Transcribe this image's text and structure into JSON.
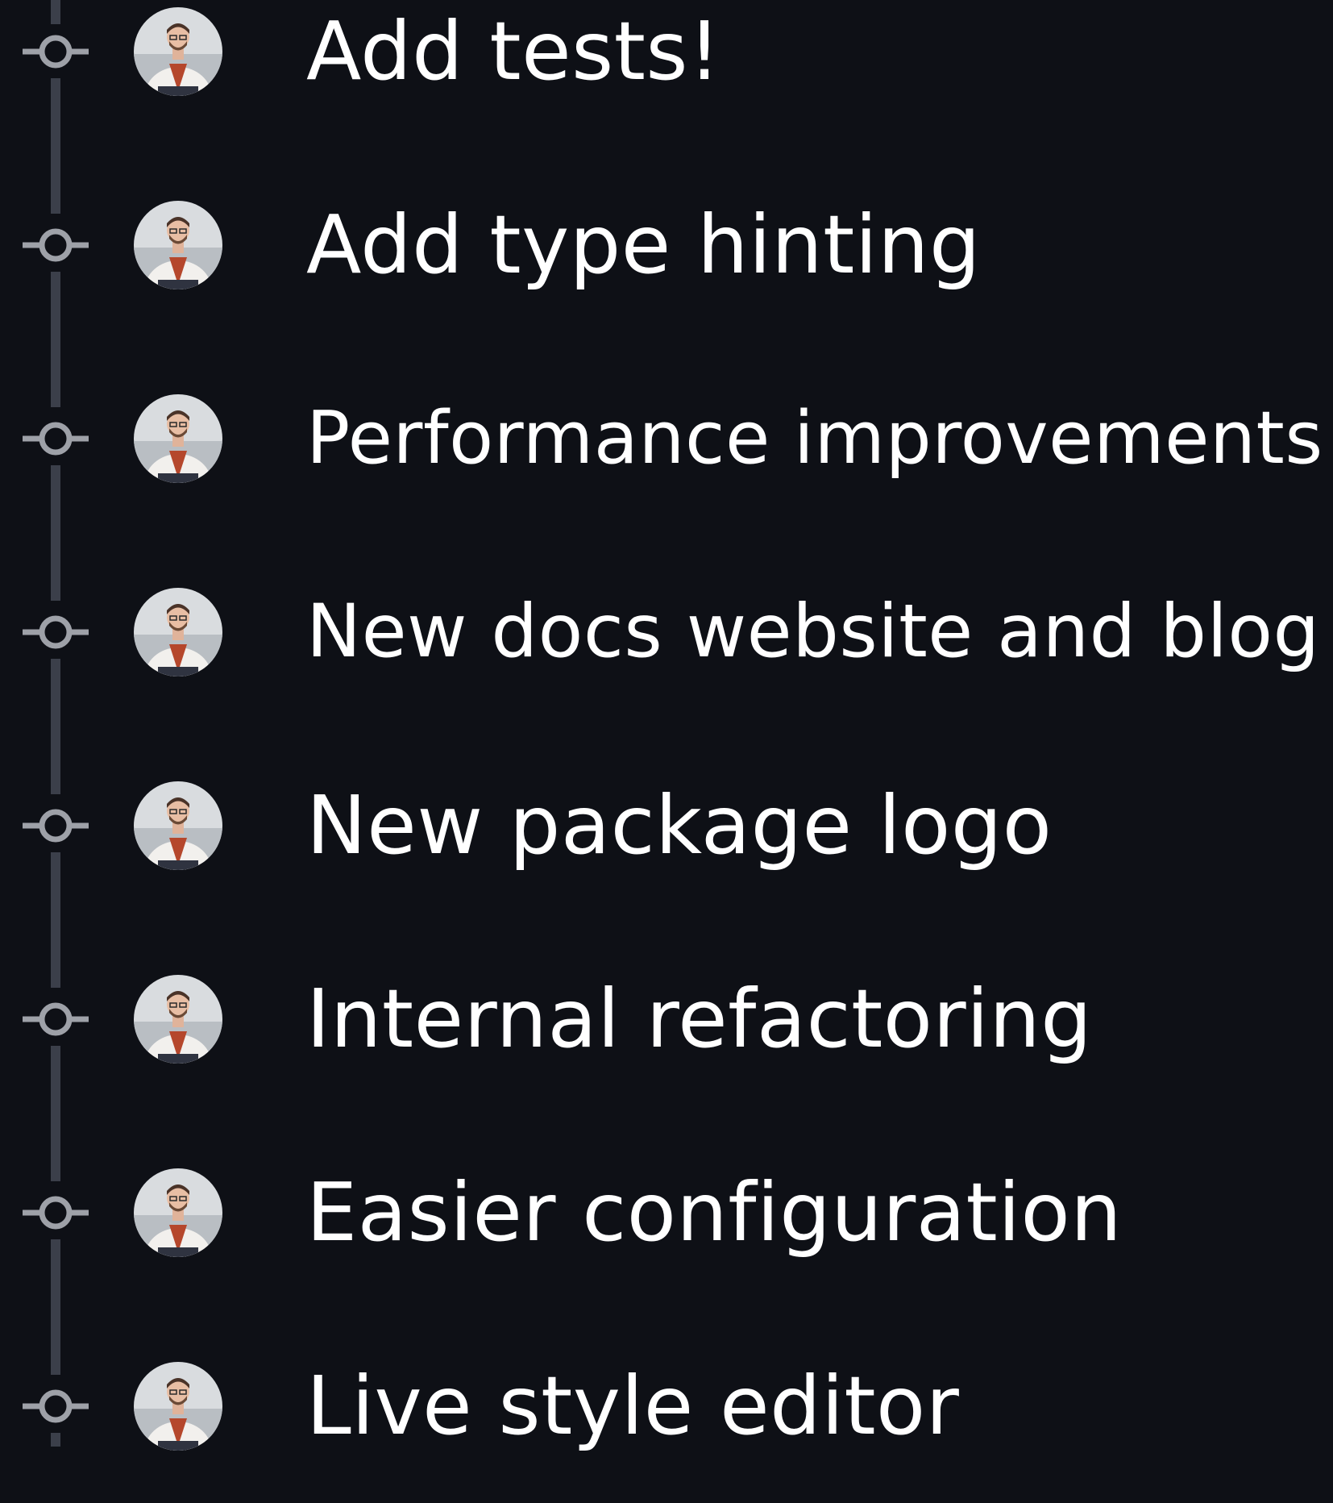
{
  "colors": {
    "background": "#0e1016",
    "rail": "#3b3f4a",
    "commit_node": "#9ea1a8",
    "text": "#ffffff"
  },
  "commits": [
    {
      "message": "Add tests!",
      "icon": "git-commit-icon",
      "avatar": "author-avatar"
    },
    {
      "message": "Add type hinting",
      "icon": "git-commit-icon",
      "avatar": "author-avatar"
    },
    {
      "message": "Performance improvements",
      "icon": "git-commit-icon",
      "avatar": "author-avatar"
    },
    {
      "message": "New docs website and blog",
      "icon": "git-commit-icon",
      "avatar": "author-avatar"
    },
    {
      "message": "New package logo",
      "icon": "git-commit-icon",
      "avatar": "author-avatar"
    },
    {
      "message": "Internal refactoring",
      "icon": "git-commit-icon",
      "avatar": "author-avatar"
    },
    {
      "message": "Easier configuration",
      "icon": "git-commit-icon",
      "avatar": "author-avatar"
    },
    {
      "message": "Live style editor",
      "icon": "git-commit-icon",
      "avatar": "author-avatar"
    }
  ]
}
